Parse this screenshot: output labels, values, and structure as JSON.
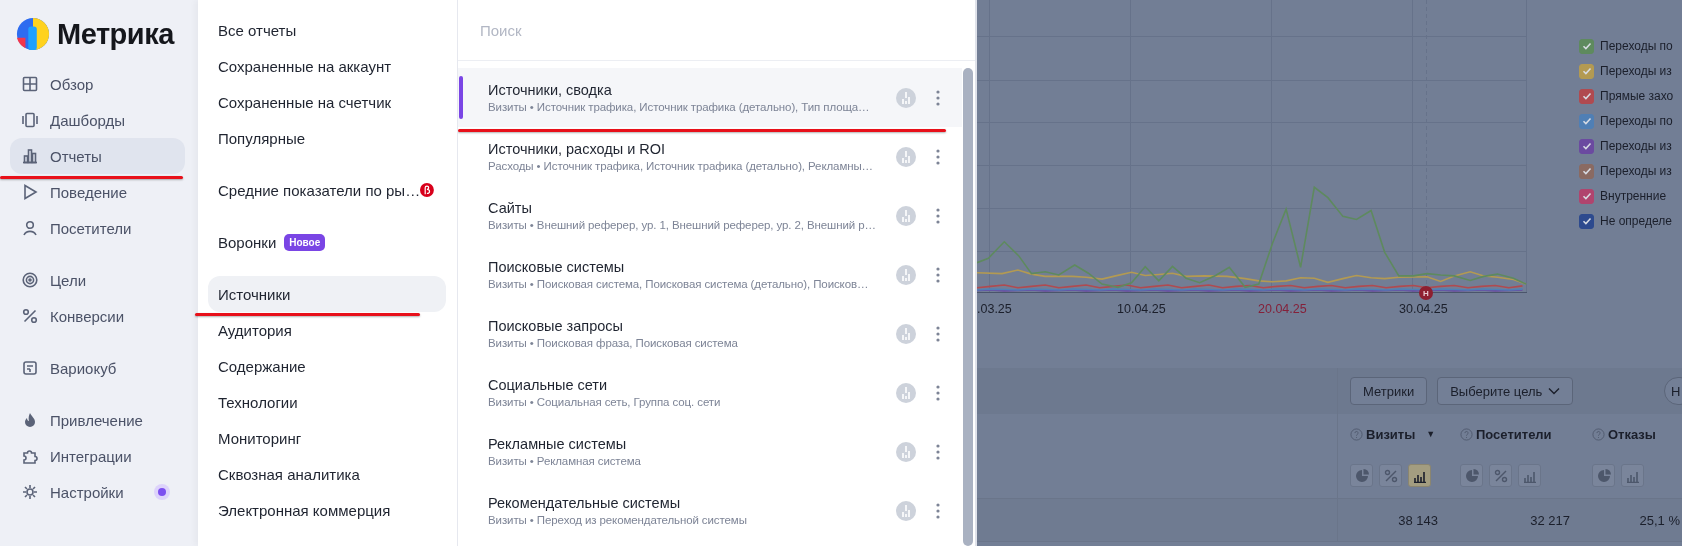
{
  "logo": {
    "text": "Метрика"
  },
  "nav_groups": [
    {
      "items": [
        {
          "label": "Обзор",
          "selected": false,
          "annotated": false,
          "dot": false
        },
        {
          "label": "Дашборды",
          "selected": false,
          "annotated": false,
          "dot": false
        },
        {
          "label": "Отчеты",
          "selected": true,
          "annotated": true,
          "dot": false
        },
        {
          "label": "Поведение",
          "selected": false,
          "annotated": false,
          "dot": false
        },
        {
          "label": "Посетители",
          "selected": false,
          "annotated": false,
          "dot": false
        }
      ]
    },
    {
      "items": [
        {
          "label": "Цели",
          "selected": false,
          "annotated": false,
          "dot": false
        },
        {
          "label": "Конверсии",
          "selected": false,
          "annotated": false,
          "dot": false
        }
      ]
    },
    {
      "items": [
        {
          "label": "Вариокуб",
          "selected": false,
          "annotated": false,
          "dot": false
        }
      ]
    },
    {
      "items": [
        {
          "label": "Привлечение",
          "selected": false,
          "annotated": false,
          "dot": false
        },
        {
          "label": "Интеграции",
          "selected": false,
          "annotated": false,
          "dot": false
        },
        {
          "label": "Настройки",
          "selected": false,
          "annotated": false,
          "dot": true
        }
      ]
    }
  ],
  "category_groups": [
    {
      "items": [
        {
          "label": "Все отчеты",
          "selected": false,
          "annotated": false,
          "beta": false
        },
        {
          "label": "Сохраненные на аккаунт",
          "selected": false,
          "annotated": false,
          "beta": false
        },
        {
          "label": "Сохраненные на счетчик",
          "selected": false,
          "annotated": false,
          "beta": false
        },
        {
          "label": "Популярные",
          "selected": false,
          "annotated": false,
          "beta": false
        }
      ]
    },
    {
      "items": [
        {
          "label": "Средние показатели по ры…",
          "selected": false,
          "annotated": false,
          "beta": true
        }
      ]
    },
    {
      "items": [
        {
          "label": "Воронки",
          "selected": false,
          "annotated": false,
          "beta": false,
          "tag": "Новое"
        }
      ]
    },
    {
      "items": [
        {
          "label": "Источники",
          "selected": true,
          "annotated": true,
          "beta": false
        },
        {
          "label": "Аудитория",
          "selected": false,
          "annotated": false,
          "beta": false
        },
        {
          "label": "Содержание",
          "selected": false,
          "annotated": false,
          "beta": false
        },
        {
          "label": "Технологии",
          "selected": false,
          "annotated": false,
          "beta": false
        },
        {
          "label": "Мониторинг",
          "selected": false,
          "annotated": false,
          "beta": false
        },
        {
          "label": "Сквозная аналитика",
          "selected": false,
          "annotated": false,
          "beta": false
        },
        {
          "label": "Электронная коммерция",
          "selected": false,
          "annotated": false,
          "beta": false
        }
      ]
    }
  ],
  "search": {
    "placeholder": "Поиск"
  },
  "reports": [
    {
      "title": "Источники, сводка",
      "subtitle": "Визиты • Источник трафика, Источник трафика (детально), Тип площа…",
      "selected": true,
      "annotated": true
    },
    {
      "title": "Источники, расходы и ROI",
      "subtitle": "Расходы • Источник трафика, Источник трафика (детально), Рекламны…",
      "selected": false,
      "annotated": false
    },
    {
      "title": "Сайты",
      "subtitle": "Визиты • Внешний реферер, ур. 1, Внешний реферер, ур. 2, Внешний р…",
      "selected": false,
      "annotated": false
    },
    {
      "title": "Поисковые системы",
      "subtitle": "Визиты • Поисковая система, Поисковая система (детально), Поисков…",
      "selected": false,
      "annotated": false
    },
    {
      "title": "Поисковые запросы",
      "subtitle": "Визиты • Поисковая фраза, Поисковая система",
      "selected": false,
      "annotated": false
    },
    {
      "title": "Социальные сети",
      "subtitle": "Визиты • Социальная сеть, Группа соц. сети",
      "selected": false,
      "annotated": false
    },
    {
      "title": "Рекламные системы",
      "subtitle": "Визиты • Рекламная система",
      "selected": false,
      "annotated": false
    },
    {
      "title": "Рекомендательные системы",
      "subtitle": "Визиты • Переход из рекомендательной системы",
      "selected": false,
      "annotated": false
    }
  ],
  "background_page": {
    "dates": [
      {
        "label": ".03.25",
        "holiday": false
      },
      {
        "label": "10.04.25",
        "holiday": false
      },
      {
        "label": "20.04.25",
        "holiday": true
      },
      {
        "label": "30.04.25",
        "holiday": false
      }
    ],
    "holiday_marker": "Н",
    "legend": [
      {
        "label": "Переходы по",
        "color": "#5e8a5e",
        "checked": true
      },
      {
        "label": "Переходы из",
        "color": "#b39a52",
        "checked": true
      },
      {
        "label": "Прямые захо",
        "color": "#b04a50",
        "checked": true
      },
      {
        "label": "Переходы по",
        "color": "#4f7fb5",
        "checked": true
      },
      {
        "label": "Переходы из",
        "color": "#6b4aa0",
        "checked": true
      },
      {
        "label": "Переходы из",
        "color": "#8a6a62",
        "checked": true
      },
      {
        "label": "Внутренние",
        "color": "#b0446e",
        "checked": true
      },
      {
        "label": "Не определе",
        "color": "#2d4a8e",
        "checked": true
      }
    ],
    "buttons": [
      {
        "label": "Метрики",
        "kind": "plain"
      },
      {
        "label": "Выберите цель",
        "kind": "dropdown"
      }
    ],
    "round_button": "Н",
    "columns": [
      {
        "label": "Визиты",
        "sort_mark": "▼",
        "value": "38 143",
        "toggles": [
          {
            "kind": "pie",
            "selected": false
          },
          {
            "kind": "percent",
            "selected": false
          },
          {
            "kind": "bars",
            "selected": true
          }
        ]
      },
      {
        "label": "Посетители",
        "value": "32 217",
        "toggles": [
          {
            "kind": "pie",
            "selected": false
          },
          {
            "kind": "percent",
            "selected": false
          },
          {
            "kind": "bars",
            "selected": false
          }
        ]
      },
      {
        "label": "Отказы",
        "value": "25,1 %",
        "toggles": [
          {
            "kind": "pie",
            "selected": false
          },
          {
            "kind": "bars",
            "selected": false
          }
        ]
      }
    ]
  }
}
